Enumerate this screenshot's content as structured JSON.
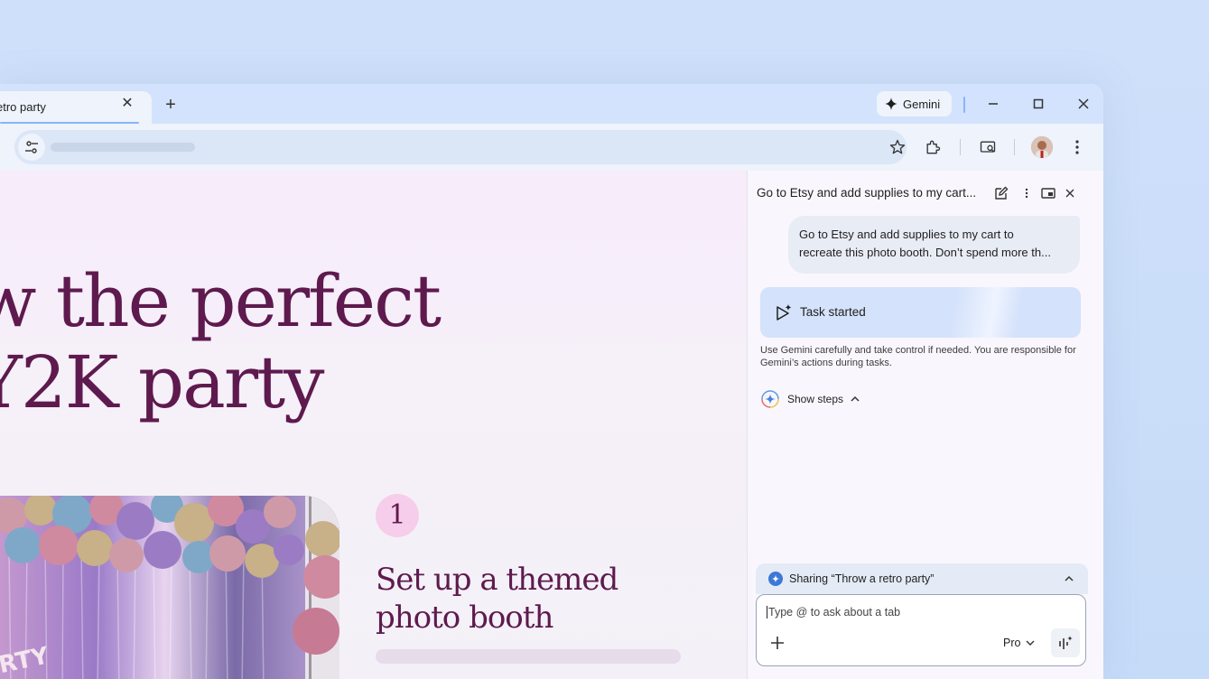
{
  "tab": {
    "title": "etro party",
    "close_icon": "close-icon",
    "new_tab_icon": "plus-icon"
  },
  "gemini_button": {
    "label": "Gemini",
    "icon": "gemini-sparkle-icon"
  },
  "window_controls": {
    "minimize": "minimize-icon",
    "maximize": "maximize-icon",
    "close": "close-icon"
  },
  "toolbar": {
    "site_settings_icon": "tune-icon",
    "bookmark_icon": "star-icon",
    "extensions_icon": "puzzle-icon",
    "tab_search_icon": "tab-search-icon",
    "menu_icon": "more-vert-icon"
  },
  "page": {
    "headline_line1": "w the perfect",
    "headline_line2": "Y2K party",
    "step_number": "1",
    "step_title": "Set up a themed photo booth",
    "photo_text": "RTY"
  },
  "panel": {
    "title": "Go to Etsy and add supplies to my cart...",
    "user_message_line1": "Go to Etsy and add supplies to my cart to",
    "user_message_line2": "recreate this photo booth. Don’t spend more th...",
    "task_status": "Task started",
    "disclaimer": "Use Gemini carefully and take control if needed. You are responsible for Gemini’s actions during tasks.",
    "show_steps": "Show steps",
    "sharing_label": "Sharing “Throw a retro party”",
    "input_placeholder": "Type @ to ask about a tab",
    "model_label": "Pro"
  },
  "colors": {
    "headline": "#5e1a4e",
    "accent": "#8ab4f8",
    "step_badge": "#f6cdea"
  }
}
